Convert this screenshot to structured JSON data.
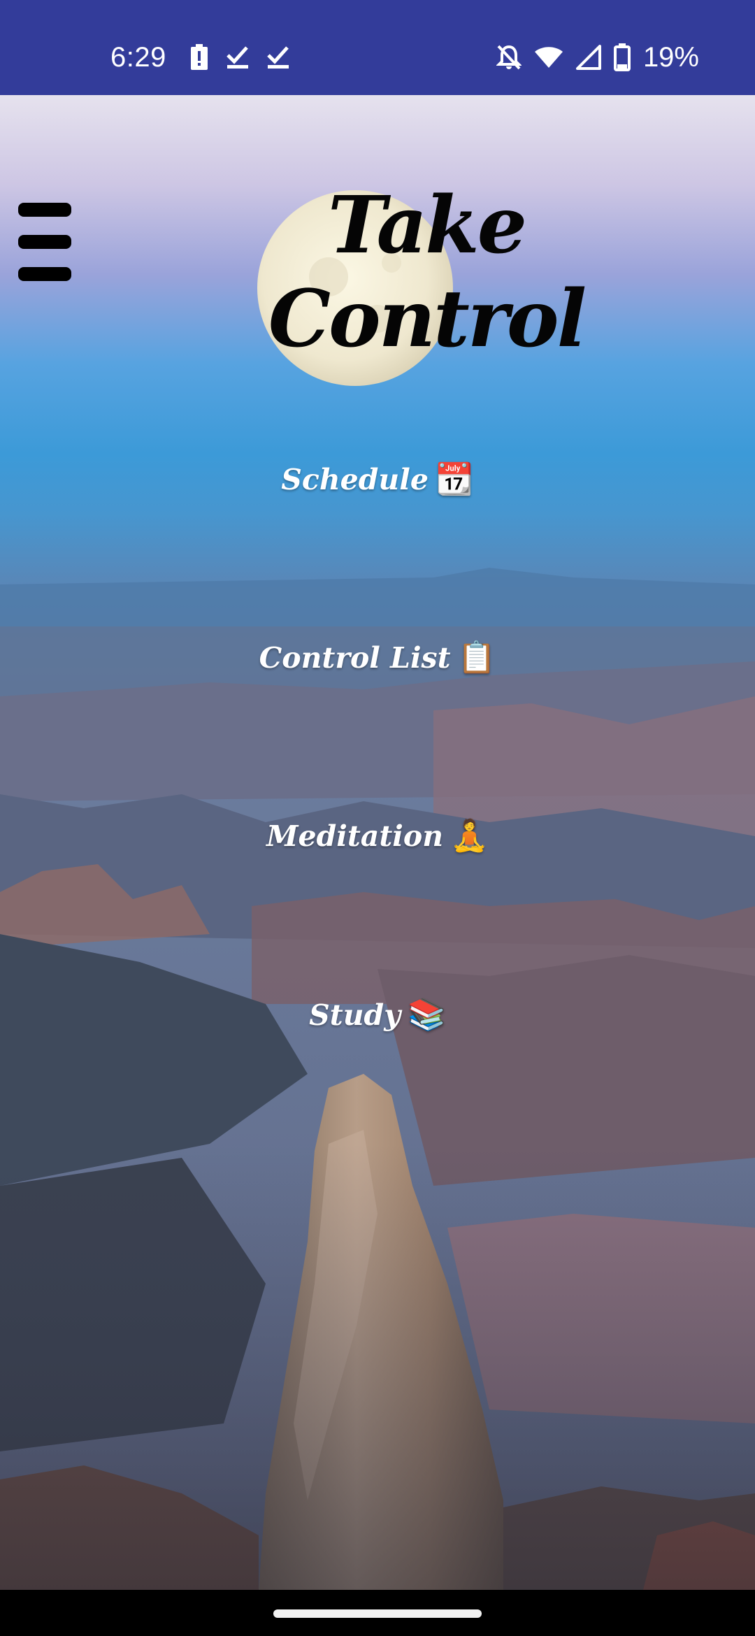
{
  "status_bar": {
    "time": "6:29",
    "battery_percent": "19%",
    "left_icons": [
      "battery-alert-icon",
      "check-icon",
      "check-icon"
    ],
    "right_icons": [
      "bell-off-icon",
      "wifi-icon",
      "signal-icon",
      "battery-icon"
    ],
    "background_color": "#333c9a"
  },
  "header": {
    "title": "Take Control",
    "menu_icon": "hamburger-menu-icon"
  },
  "nav": {
    "items": [
      {
        "label": "Schedule",
        "emoji": "📆"
      },
      {
        "label": "Control List",
        "emoji": "📋"
      },
      {
        "label": "Meditation",
        "emoji": "🧘"
      },
      {
        "label": "Study",
        "emoji": "📚"
      }
    ]
  },
  "background": {
    "description_icon": "moon-canyon-landscape-image"
  }
}
